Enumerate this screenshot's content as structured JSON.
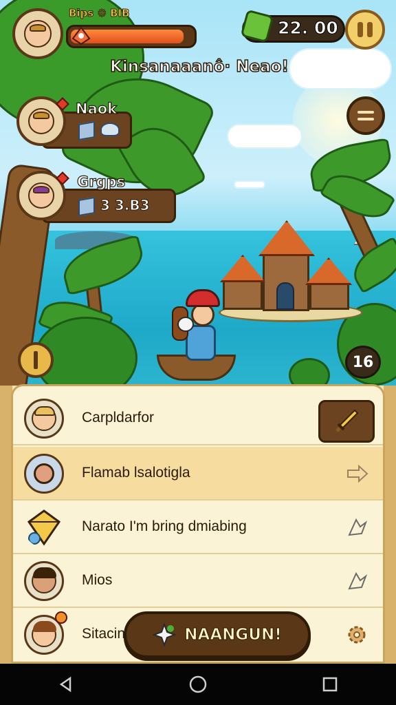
{
  "hud": {
    "health_label": "Bips ⚙ BIB",
    "health_fraction": 0.93,
    "currency": "22. 00",
    "banner": "Kinsanaaanô· Neao!",
    "counter": "16"
  },
  "characters": [
    {
      "name": "Naok",
      "stat": ""
    },
    {
      "name": "Grgps",
      "stat": "3 3.B3"
    }
  ],
  "menu": {
    "items": [
      {
        "label": "Carpldarfor"
      },
      {
        "label": "Flamab lsalotigla"
      },
      {
        "label": "Narato I'm bring dmiabing"
      },
      {
        "label": "Mios"
      },
      {
        "label": "Sitacin"
      }
    ],
    "cta_label": "NAANGUN!"
  },
  "colors": {
    "wood": "#5a3716",
    "panel": "#fbf3d6",
    "highlight": "#f6dc9e",
    "health": "#e0501c",
    "gem": "#69c23a"
  }
}
